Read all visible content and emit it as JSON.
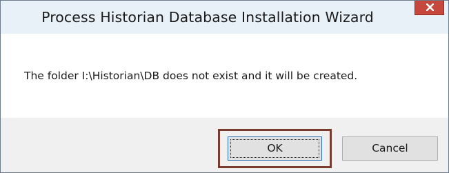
{
  "window": {
    "title": "Process Historian Database Installation Wizard",
    "close_icon": "close-x-icon"
  },
  "dialog": {
    "message": "The folder I:\\Historian\\DB does not exist and it will be created."
  },
  "buttons": {
    "ok_label": "OK",
    "cancel_label": "Cancel"
  },
  "colors": {
    "title_bar": "#e8f1f8",
    "close_button": "#c7473d",
    "highlight_border": "#7b3a2e",
    "footer": "#f0f0f0"
  }
}
